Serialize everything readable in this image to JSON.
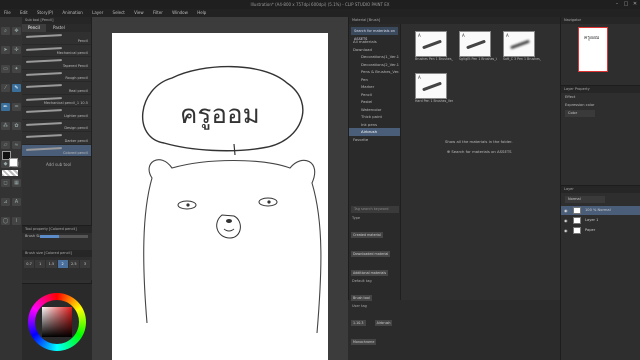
{
  "window": {
    "title": "Illustration* (A4-800 x 757dpi 600dpi) (5.1%) - CLIP STUDIO PAINT EX",
    "minimize": "–",
    "maximize": "□",
    "close": "✕"
  },
  "menu": [
    "File",
    "Edit",
    "Story(P)",
    "Animation",
    "Layer",
    "Select",
    "View",
    "Filter",
    "Window",
    "Help"
  ],
  "subtool": {
    "header": "Sub tool [Pencil]",
    "tabs": [
      "Pencil",
      "Pastel"
    ],
    "active_tab": "Pencil",
    "items": [
      {
        "label": "Pencil"
      },
      {
        "label": "Mechanical pencil"
      },
      {
        "label": "Tapered Pencil"
      },
      {
        "label": "Rough pencil"
      },
      {
        "label": "Real pencil"
      },
      {
        "label": "Mechanical pencil_1 10.5"
      },
      {
        "label": "Lighter pencil"
      },
      {
        "label": "Design pencil"
      },
      {
        "label": "Darker pencil"
      },
      {
        "label": "Colored pencil"
      }
    ],
    "selected_index": 9,
    "add_label": "Add sub tool"
  },
  "tool_property": {
    "header": "Tool property [Colored pencil]",
    "brush_size_label": "Brush Size",
    "brush_size_fraction": 0.4,
    "presets_header": "Brush size [Colored pencil]",
    "presets": [
      "0.7",
      "1",
      "1.5",
      "2",
      "2.5",
      "3"
    ],
    "selected_preset": 3
  },
  "canvas": {
    "bubble_text": "ครูออม"
  },
  "material": {
    "header": "Material [Brush]",
    "search_label": "Search for materials on ASSETS",
    "tree": [
      {
        "label": "All materials",
        "level": 1
      },
      {
        "label": "Download",
        "level": 1
      },
      {
        "label": "Decorations(1_Ver.1",
        "level": 2
      },
      {
        "label": "Decorations(2_Ver.1",
        "level": 2
      },
      {
        "label": "Pens & Brushes_Ver.1",
        "level": 2
      },
      {
        "label": "Pen",
        "level": 2
      },
      {
        "label": "Marker",
        "level": 2
      },
      {
        "label": "Pencil",
        "level": 2
      },
      {
        "label": "Pastel",
        "level": 2
      },
      {
        "label": "Watercolor",
        "level": 2
      },
      {
        "label": "Thick paint",
        "level": 2
      },
      {
        "label": "Ink pens",
        "level": 2
      },
      {
        "label": "Airbrush",
        "level": 2
      },
      {
        "label": "Favorite",
        "level": 1
      }
    ],
    "selected_tree": 12,
    "thumbnails": [
      {
        "label": "Brushes Pen 1 Brushes_Ver.1"
      },
      {
        "label": "SgVgEt Pen 1 Brushes_Ver.1"
      },
      {
        "label": "Soft_C 3 Pen 1 Brushes_Ver.1"
      },
      {
        "label": "Hard Pen 1 Brushes_Ver.1 3.5"
      }
    ],
    "empty_message": "Show all the materials in the folder.",
    "assets_link": "Search for materials on ASSETS",
    "tag_search_placeholder": "Tag search keyword",
    "type_label": "Type",
    "type_tags": [
      "Created material",
      "Downloaded material",
      "Additional materials"
    ],
    "default_tag_label": "Default tag",
    "default_tags": [
      "Brush tool"
    ],
    "user_tag_label": "User tag",
    "user_tags": [
      "1.10.3",
      "Airbrush",
      "Monochrome"
    ]
  },
  "navigator": {
    "header": "Navigator",
    "preview_text": "ครูออม"
  },
  "layer_property": {
    "header": "Layer Property",
    "effect_label": "Effect",
    "expression_label": "Expression color",
    "expression_value": "Color"
  },
  "layers": {
    "header": "Layer",
    "blend_mode": "Normal",
    "items": [
      {
        "name": "100 % Normal"
      },
      {
        "name": "Layer 1"
      },
      {
        "name": "Paper"
      }
    ],
    "selected_index": 0
  }
}
